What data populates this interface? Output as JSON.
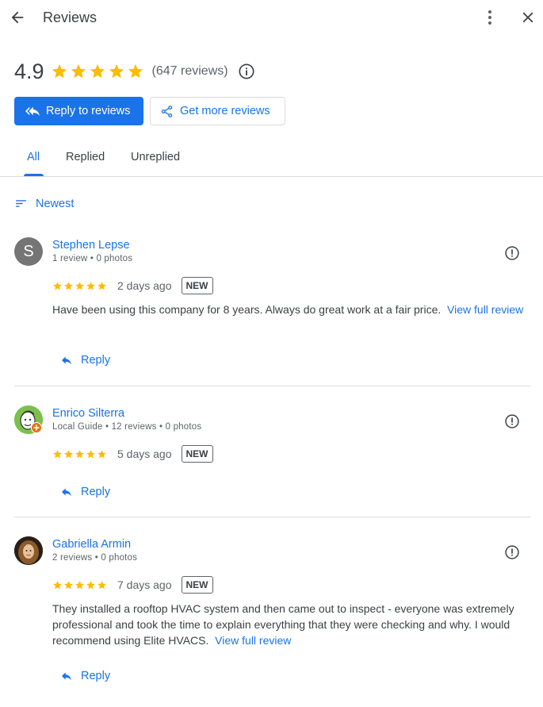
{
  "header": {
    "title": "Reviews",
    "back_icon": "arrow-left-icon",
    "more_icon": "more-vert-icon",
    "close_icon": "close-icon"
  },
  "summary": {
    "rating": "4.9",
    "stars": 5,
    "count_text": "(647 reviews)",
    "info_icon": "info-icon"
  },
  "actions": {
    "reply_label": "Reply to reviews",
    "get_more_label": "Get more reviews"
  },
  "tabs": [
    {
      "label": "All",
      "active": true
    },
    {
      "label": "Replied",
      "active": false
    },
    {
      "label": "Unreplied",
      "active": false
    }
  ],
  "sort": {
    "label": "Newest"
  },
  "colors": {
    "accent": "#1a73e8",
    "star": "#fbbc04",
    "divider": "#dadce0",
    "text": "#3c4043",
    "muted": "#5f6368"
  },
  "reviews": [
    {
      "name": "Stephen Lepse",
      "avatar_letter": "S",
      "meta": "1 review • 0 photos",
      "stars": 5,
      "time": "2 days ago",
      "badge": "NEW",
      "text": "Have been using this company for 8 years. Always do great work at a fair price.",
      "link": "View full review",
      "reply_label": "Reply"
    },
    {
      "name": "Enrico Silterra",
      "meta": "Local Guide • 12 reviews • 0 photos",
      "stars": 5,
      "time": "5 days ago",
      "badge": "NEW",
      "reply_label": "Reply"
    },
    {
      "name": "Gabriella Armin",
      "meta": "2 reviews • 0 photos",
      "stars": 5,
      "time": "7 days ago",
      "badge": "NEW",
      "text": "They installed a rooftop HVAC system and then came out to inspect - everyone was extremely professional and took the time to explain everything that they were checking and why. I would recommend using Elite HVACS.",
      "link": "View full review",
      "reply_label": "Reply"
    }
  ]
}
